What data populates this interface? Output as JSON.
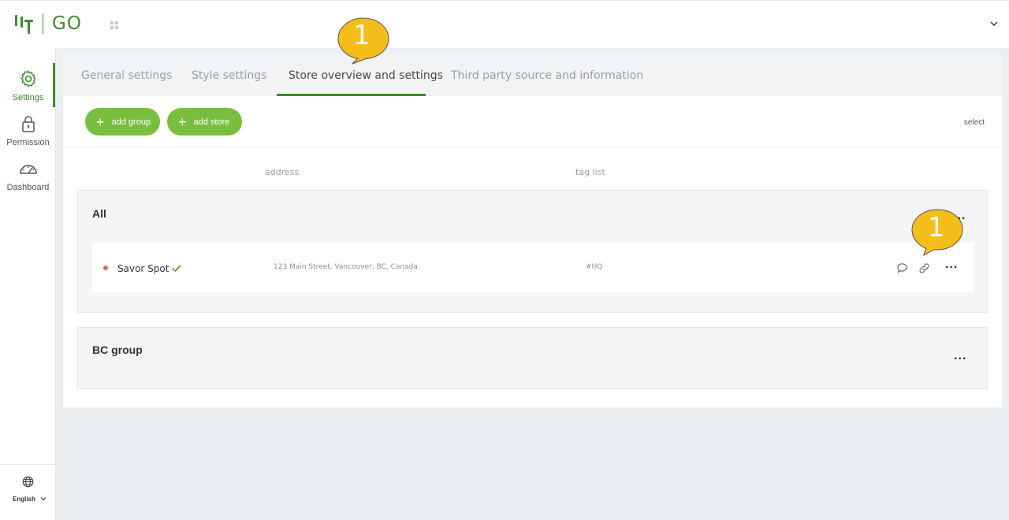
{
  "app": {
    "logo_text": "GO",
    "brand_color": "#3d8c2b"
  },
  "sidebar": {
    "items": [
      {
        "label": "Settings",
        "icon": "gear-icon",
        "active": true
      },
      {
        "label": "Permission",
        "icon": "lock-icon",
        "active": false
      },
      {
        "label": "Dashboard",
        "icon": "speedometer-icon",
        "active": false
      }
    ],
    "language": "English"
  },
  "tabs": [
    {
      "label": "General settings",
      "active": false
    },
    {
      "label": "Style settings",
      "active": false
    },
    {
      "label": "Store overview and settings",
      "active": true
    },
    {
      "label": "Third party source and information",
      "active": false
    }
  ],
  "toolbar": {
    "add_group_label": "add group",
    "add_store_label": "add store",
    "select_label": "select"
  },
  "columns": {
    "address": "address",
    "tag_list": "tag list"
  },
  "groups": [
    {
      "title": "All",
      "menu": "...",
      "stores": [
        {
          "name": "Savor Spot",
          "verified": true,
          "status_color": "#e06666",
          "address": "123 Main Street, Vancouver, BC, Canada",
          "tags": "#HQ",
          "menu": "..."
        }
      ]
    },
    {
      "title": "BC group",
      "menu": "...",
      "stores": []
    }
  ],
  "callouts": [
    {
      "number": "1",
      "color": "#f5be1b"
    },
    {
      "number": "1",
      "color": "#f5be1b"
    }
  ]
}
